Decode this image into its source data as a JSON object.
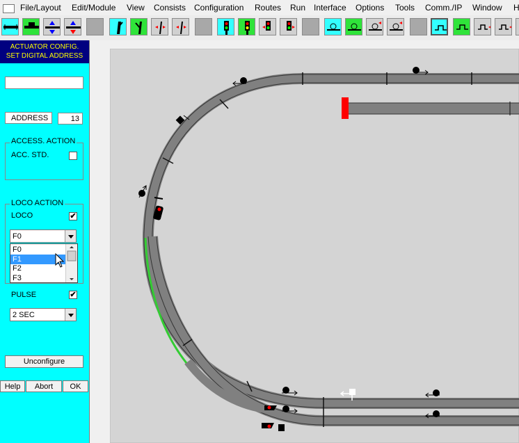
{
  "menubar": {
    "items": [
      "File/Layout",
      "Edit/Module",
      "View",
      "Consists",
      "Configuration",
      "Routes",
      "Run",
      "Interface",
      "Options",
      "Tools",
      "Comm./IP",
      "Window",
      "H"
    ]
  },
  "panel": {
    "title_line1": "ACTUATOR CONFIG.",
    "title_line2": "SET DIGITAL ADDRESS",
    "name_value": "",
    "address_label": "ADDRESS",
    "address_value": "13",
    "access_group_title": "ACCESS. ACTION",
    "acc_std_label": "ACC. STD.",
    "loco_group_title": "LOCO ACTION",
    "loco_label": "LOCO",
    "function_selected": "F0",
    "function_options": [
      "F0",
      "F1",
      "F2",
      "F3"
    ],
    "function_highlighted": "F1",
    "pulse_label": "PULSE",
    "duration_selected": "2 SEC",
    "unconfigure_label": "Unconfigure",
    "help_label": "Help",
    "abort_label": "Abort",
    "ok_label": "OK"
  },
  "colors": {
    "panel_bg": "#00ffff",
    "title_bg": "#000080",
    "title_fg": "#ffff00",
    "track": "#808080",
    "route_active": "#33cc33",
    "buffer_stop": "#ff0000"
  }
}
